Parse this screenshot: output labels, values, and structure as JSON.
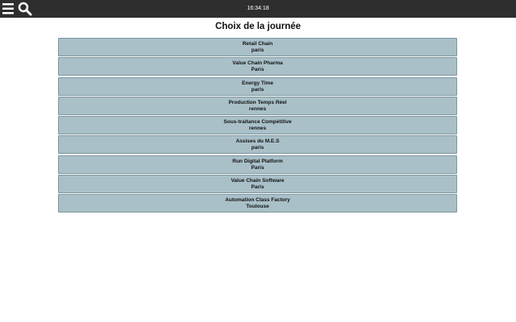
{
  "header": {
    "menu_icon": "hamburger-menu-icon",
    "search_icon": "search-icon",
    "time": "16:34:18",
    "background": "#2e2e2e"
  },
  "main": {
    "title": "Choix de la journée",
    "item_color": "#a9c0c8",
    "events": [
      {
        "name": "Retail Chain",
        "city": "paris"
      },
      {
        "name": "Value Chain Pharma",
        "city": "Paris"
      },
      {
        "name": "Energy Time",
        "city": "paris"
      },
      {
        "name": "Production Temps Réel",
        "city": "rennes"
      },
      {
        "name": "Sous-traitance Compétitive",
        "city": "rennes"
      },
      {
        "name": "Assises du M.E.S",
        "city": "paris"
      },
      {
        "name": "Run Digital Platform",
        "city": "Paris"
      },
      {
        "name": "Value Chain Software",
        "city": "Paris"
      },
      {
        "name": "Automation Class Factory",
        "city": "Toulouse"
      }
    ]
  }
}
